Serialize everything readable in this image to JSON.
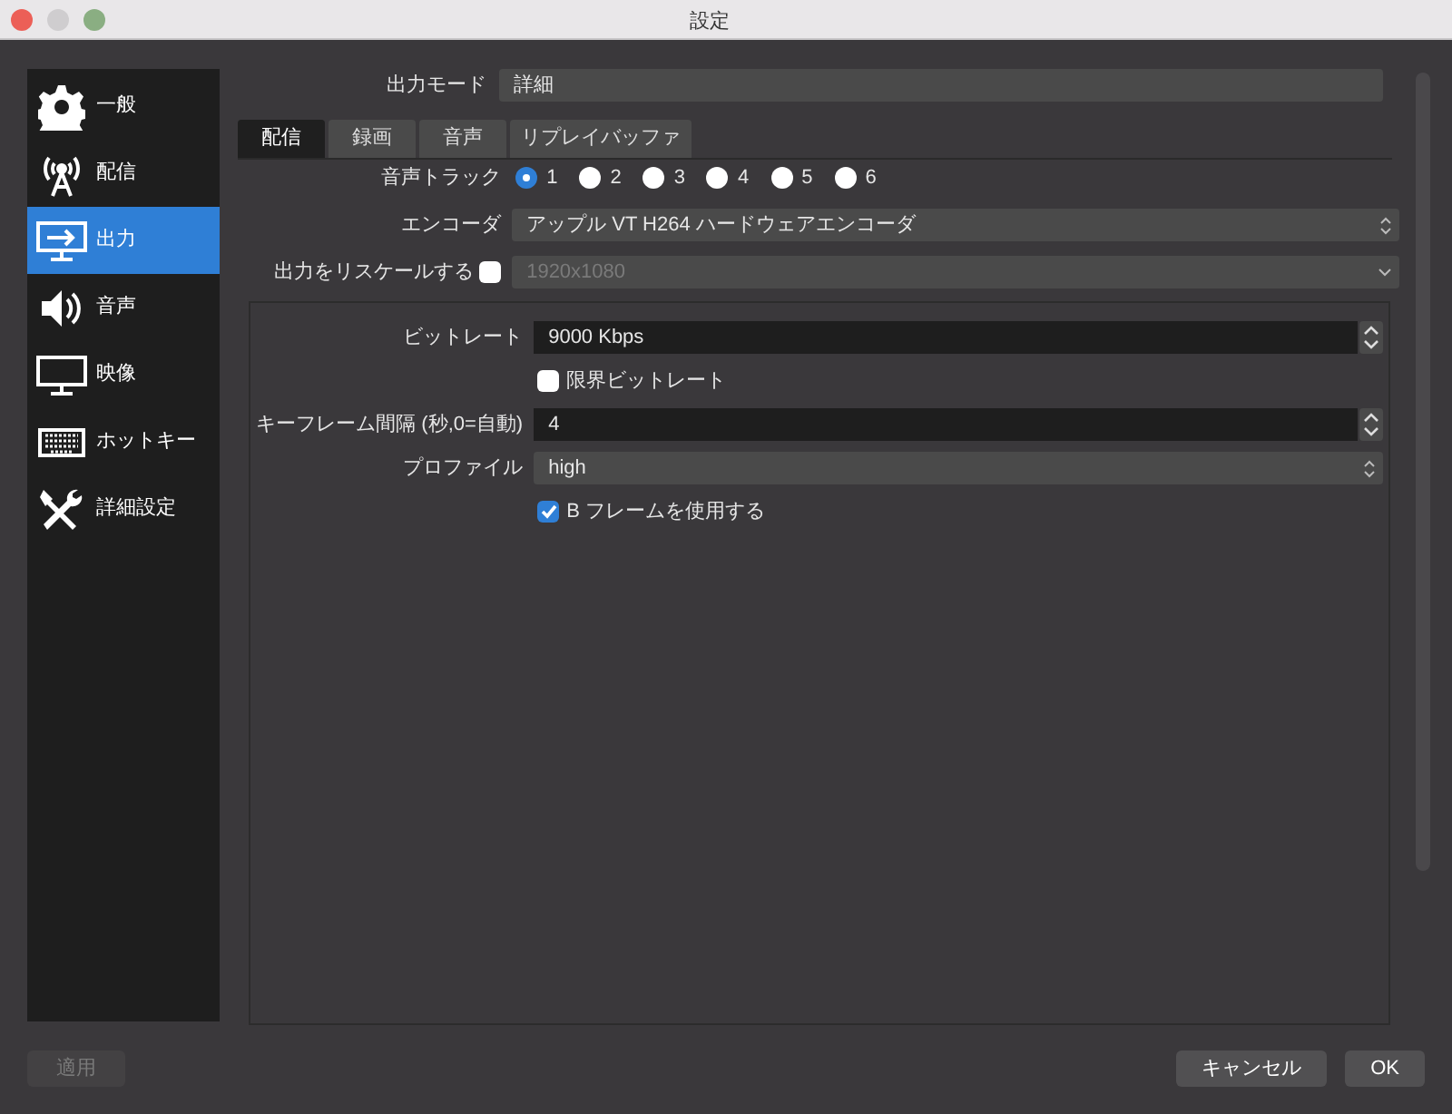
{
  "window": {
    "title": "設定"
  },
  "sidebar": {
    "items": [
      {
        "label": "一般",
        "kind": "general",
        "selected": false
      },
      {
        "label": "配信",
        "kind": "stream",
        "selected": false
      },
      {
        "label": "出力",
        "kind": "output",
        "selected": true
      },
      {
        "label": "音声",
        "kind": "audio",
        "selected": false
      },
      {
        "label": "映像",
        "kind": "video",
        "selected": false
      },
      {
        "label": "ホットキー",
        "kind": "hotkeys",
        "selected": false
      },
      {
        "label": "詳細設定",
        "kind": "advanced",
        "selected": false
      }
    ]
  },
  "output_mode": {
    "label": "出力モード",
    "value": "詳細"
  },
  "tabs": [
    {
      "label": "配信",
      "selected": true
    },
    {
      "label": "録画",
      "selected": false
    },
    {
      "label": "音声",
      "selected": false
    },
    {
      "label": "リプレイバッファ",
      "selected": false
    }
  ],
  "audio_track": {
    "label": "音声トラック",
    "options": [
      {
        "label": "1",
        "selected": true
      },
      {
        "label": "2",
        "selected": false
      },
      {
        "label": "3",
        "selected": false
      },
      {
        "label": "4",
        "selected": false
      },
      {
        "label": "5",
        "selected": false
      },
      {
        "label": "6",
        "selected": false
      }
    ]
  },
  "encoder": {
    "label": "エンコーダ",
    "value": "アップル VT H264 ハードウェアエンコーダ"
  },
  "rescale": {
    "label": "出力をリスケールする",
    "checked": false,
    "value": "1920x1080",
    "disabled": true
  },
  "settings": [
    {
      "kind": "spin",
      "label": "ビットレート",
      "value": "9000 Kbps"
    },
    {
      "kind": "checkbox",
      "label": "限界ビットレート",
      "checked": false
    },
    {
      "kind": "spin",
      "label": "キーフレーム間隔 (秒,0=自動)",
      "value": "4"
    },
    {
      "kind": "select",
      "label": "プロファイル",
      "value": "high"
    },
    {
      "kind": "checkbox",
      "label": "B フレームを使用する",
      "checked": true
    }
  ],
  "buttons": [
    {
      "label": "適用",
      "disabled": true
    },
    {
      "label": "キャンセル",
      "disabled": false
    },
    {
      "label": "OK",
      "disabled": false
    }
  ]
}
